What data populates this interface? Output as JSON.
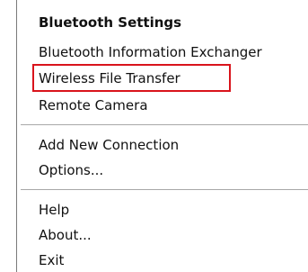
{
  "menu": {
    "items": [
      {
        "label": "Bluetooth Settings",
        "default": true
      },
      {
        "label": "Bluetooth Information Exchanger"
      },
      {
        "label": "Wireless File Transfer",
        "highlighted": true
      },
      {
        "label": "Remote Camera"
      },
      {
        "label": "Add New Connection"
      },
      {
        "label": "Options..."
      },
      {
        "label": "Help"
      },
      {
        "label": "About..."
      },
      {
        "label": "Exit"
      }
    ]
  },
  "colors": {
    "highlight_border": "#d9141c",
    "menu_border": "#7a7a7a",
    "separator": "#a8a8a8",
    "text": "#111111"
  }
}
